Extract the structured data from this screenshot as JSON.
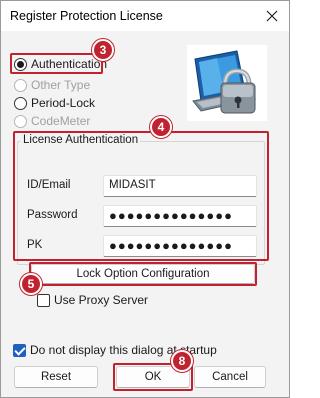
{
  "window": {
    "title": "Register Protection License"
  },
  "modes": [
    {
      "label": "Authentication",
      "checked": true,
      "disabled": false
    },
    {
      "label": "Other Type",
      "checked": false,
      "disabled": true
    },
    {
      "label": "Period-Lock",
      "checked": false,
      "disabled": false
    },
    {
      "label": "CodeMeter",
      "checked": false,
      "disabled": true
    }
  ],
  "license_auth": {
    "group_title": "License Authentication",
    "id_label": "ID/Email",
    "id_value": "MIDASIT",
    "password_label": "Password",
    "password_value": "●●●●●●●●●●●●●●",
    "pk_label": "PK",
    "pk_value": "●●●●●●●●●●●●●●"
  },
  "lock_option_button": "Lock Option Configuration",
  "use_proxy": {
    "label": "Use Proxy Server",
    "checked": false
  },
  "do_not_display": {
    "label": "Do not display this dialog at startup",
    "checked": true
  },
  "buttons": {
    "reset": "Reset",
    "ok": "OK",
    "cancel": "Cancel"
  },
  "annotations": {
    "badge_3": "3",
    "badge_4": "4",
    "badge_5": "5",
    "badge_8": "8"
  },
  "colors": {
    "highlight": "#c0232f",
    "checkbox_accent": "#1f5fbf"
  },
  "icons": {
    "hero": "computer-padlock-icon",
    "close": "close-icon"
  }
}
